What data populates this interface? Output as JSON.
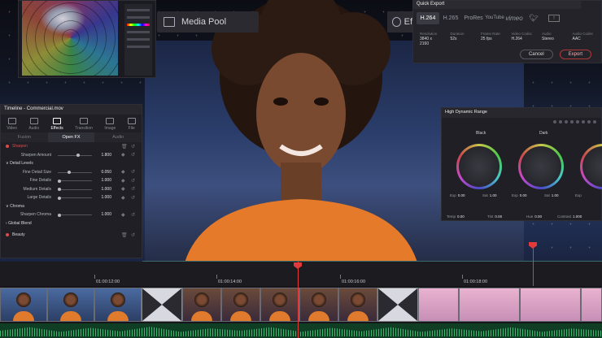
{
  "media_pool": {
    "label": "Media Pool",
    "icon": "media-pool-icon"
  },
  "effects_tab": {
    "label": "Effe",
    "icon": "effects-icon"
  },
  "quick_export": {
    "title": "Quick Export",
    "formats": [
      "H.264",
      "H.265",
      "ProRes"
    ],
    "selected_format": "H.264",
    "service_icons": [
      "youtube-icon",
      "vimeo-icon",
      "twitter-icon",
      "upload-icon"
    ],
    "service_labels": {
      "youtube": "YouTube",
      "vimeo": "vimeo"
    },
    "meta": [
      {
        "label": "Resolution",
        "value": "3840 x 2160"
      },
      {
        "label": "Duration",
        "value": "52s"
      },
      {
        "label": "Frame Rate",
        "value": "25 fps"
      },
      {
        "label": "Video Codec",
        "value": "H.264"
      },
      {
        "label": "Audio",
        "value": "Stereo"
      },
      {
        "label": "Audio Codec",
        "value": "AAC"
      }
    ],
    "cancel_label": "Cancel",
    "export_label": "Export"
  },
  "inspector": {
    "title": "Timeline - Commercial.mov",
    "tabs": [
      "Video",
      "Audio",
      "Effects",
      "Transition",
      "Image",
      "File"
    ],
    "selected_tab": "Effects",
    "subtabs": [
      "Fusion",
      "Open FX",
      "Audio"
    ],
    "selected_subtab": "Open FX",
    "effect_name": "Sharpen",
    "rows": [
      {
        "label": "Sharpen Amount",
        "value": "1.800",
        "pos": 0.55
      },
      {
        "section": "Detail Levels"
      },
      {
        "label": "Fine Detail Size",
        "value": "0.050",
        "pos": 0.3
      },
      {
        "label": "Fine Details",
        "value": "1.000",
        "pos": 0.0
      },
      {
        "label": "Medium Details",
        "value": "1.000",
        "pos": 0.0
      },
      {
        "label": "Large Details",
        "value": "1.000",
        "pos": 0.0
      },
      {
        "section": "Chroma"
      },
      {
        "label": "Sharpen Chroma",
        "value": "1.000",
        "pos": 0.0
      },
      {
        "section": "Global Blend"
      }
    ],
    "second_effect": "Beauty"
  },
  "hdr": {
    "title": "High Dynamic Range",
    "wheels": [
      {
        "name": "Black",
        "exp": "Exp",
        "exp_val": "0.00",
        "sat": "Sat",
        "sat_val": "1.00"
      },
      {
        "name": "Dark",
        "exp": "Exp",
        "exp_val": "0.00",
        "sat": "Sat",
        "sat_val": "1.00"
      },
      {
        "name": "",
        "exp": "Exp",
        "exp_val": "",
        "sat": "",
        "sat_val": ""
      }
    ],
    "bottom": [
      {
        "label": "Temp",
        "value": "0.00"
      },
      {
        "label": "Tint",
        "value": "0.00"
      },
      {
        "label": "Hue",
        "value": "0.00"
      },
      {
        "label": "Contrast",
        "value": "1.000"
      }
    ]
  },
  "timeline": {
    "timecodes": [
      "01:00:12:00",
      "01:00:14:00",
      "01:00:16:00",
      "01:00:18:00"
    ],
    "playhead_color": "#e23a3a"
  },
  "colors": {
    "accent_red": "#e24a4a",
    "panel": "#1e1e24",
    "audio_green": "#3fcf7a"
  }
}
